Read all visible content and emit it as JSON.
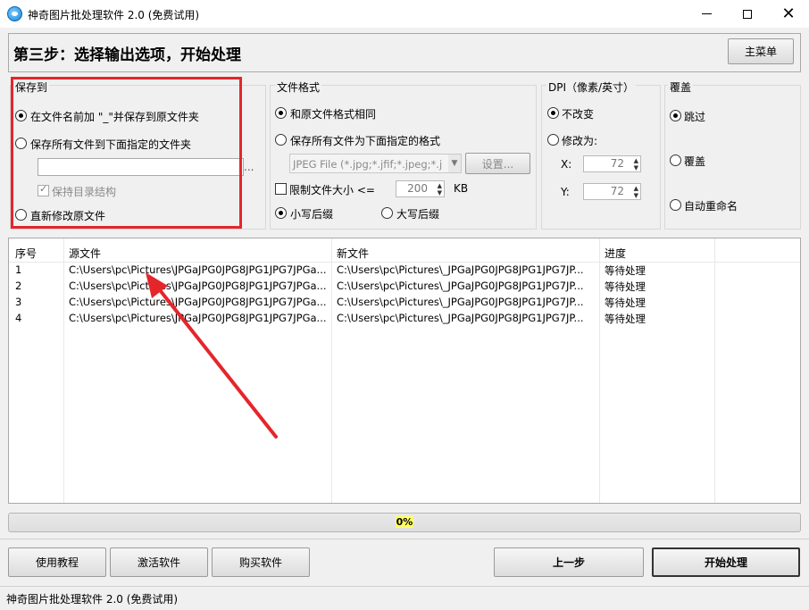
{
  "window": {
    "title": "神奇图片批处理软件 2.0 (免费试用)"
  },
  "header": {
    "step_title": "第三步：选择输出选项，开始处理",
    "main_menu_label": "主菜单"
  },
  "save_to": {
    "label": "保存到",
    "option_prefix": "在文件名前加 \"_\"并保存到原文件夹",
    "option_folder": "保存所有文件到下面指定的文件夹",
    "folder_value": "",
    "browse_label": "...",
    "keep_structure": "保持目录结构",
    "option_overwrite": "直新修改原文件"
  },
  "file_format": {
    "label": "文件格式",
    "same_format": "和原文件格式相同",
    "save_as_format": "保存所有文件为下面指定的格式",
    "format_value": "JPEG File (*.jpg;*.jfif;*.jpeg;*.j",
    "settings_label": "设置...",
    "limit_size_label": "限制文件大小 <=",
    "limit_size_value": "200",
    "size_unit": "KB",
    "lowercase_ext": "小写后缀",
    "uppercase_ext": "大写后缀"
  },
  "dpi": {
    "label": "DPI（像素/英寸）",
    "unchanged": "不改变",
    "modify_to": "修改为:",
    "x_label": "X:",
    "x_value": "72",
    "y_label": "Y:",
    "y_value": "72"
  },
  "overwrite": {
    "label": "覆盖",
    "skip": "跳过",
    "cover": "覆盖",
    "auto_rename": "自动重命名"
  },
  "table": {
    "headers": [
      "序号",
      "源文件",
      "新文件",
      "进度"
    ],
    "rows": [
      {
        "index": "1",
        "source": "C:\\Users\\pc\\Pictures\\JPGaJPG0JPG8JPG1JPG7JPGa...",
        "target": "C:\\Users\\pc\\Pictures\\_JPGaJPG0JPG8JPG1JPG7JP...",
        "status": "等待处理"
      },
      {
        "index": "2",
        "source": "C:\\Users\\pc\\Pictures\\JPGaJPG0JPG8JPG1JPG7JPGa...",
        "target": "C:\\Users\\pc\\Pictures\\_JPGaJPG0JPG8JPG1JPG7JP...",
        "status": "等待处理"
      },
      {
        "index": "3",
        "source": "C:\\Users\\pc\\Pictures\\JPGaJPG0JPG8JPG1JPG7JPGa...",
        "target": "C:\\Users\\pc\\Pictures\\_JPGaJPG0JPG8JPG1JPG7JP...",
        "status": "等待处理"
      },
      {
        "index": "4",
        "source": "C:\\Users\\pc\\Pictures\\JPGaJPG0JPG8JPG1JPG7JPGa...",
        "target": "C:\\Users\\pc\\Pictures\\_JPGaJPG0JPG8JPG1JPG7JP...",
        "status": "等待处理"
      }
    ]
  },
  "progress": {
    "text": "0%",
    "fraction": 0
  },
  "footer": {
    "tutorial": "使用教程",
    "activate": "激活软件",
    "buy": "购买软件",
    "prev": "上一步",
    "start": "开始处理"
  },
  "statusbar": {
    "text": "神奇图片批处理软件 2.0 (免费试用)"
  },
  "colors": {
    "annotation_red": "#e4262b"
  }
}
